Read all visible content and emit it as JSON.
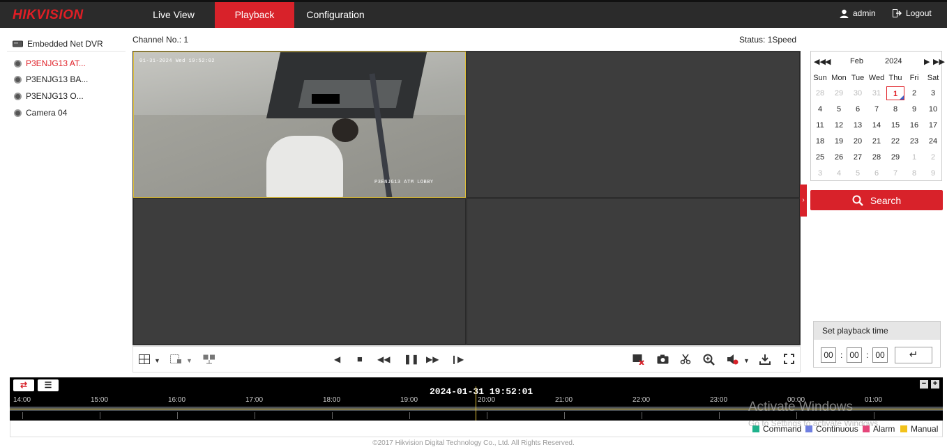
{
  "header": {
    "logo": "HIKVISION",
    "tabs": [
      {
        "label": "Live View"
      },
      {
        "label": "Playback"
      },
      {
        "label": "Configuration"
      }
    ],
    "user": "admin",
    "logout": "Logout"
  },
  "sidebar": {
    "device": "Embedded Net DVR",
    "cameras": [
      {
        "label": "P3ENJG13 AT..."
      },
      {
        "label": "P3ENJG13 BA..."
      },
      {
        "label": "P3ENJG13 O..."
      },
      {
        "label": "Camera 04"
      }
    ]
  },
  "channel": "Channel No.: 1",
  "status": "Status: 1Speed",
  "video": {
    "osd_time": "01-31-2024 Wed 19:52:02",
    "osd_name": "P3ENJG13 ATM LOBBY"
  },
  "calendar": {
    "month": "Feb",
    "year": "2024",
    "weekdays": [
      "Sun",
      "Mon",
      "Tue",
      "Wed",
      "Thu",
      "Fri",
      "Sat"
    ],
    "rows": [
      [
        "28",
        "29",
        "30",
        "31",
        "1",
        "2",
        "3"
      ],
      [
        "4",
        "5",
        "6",
        "7",
        "8",
        "9",
        "10"
      ],
      [
        "11",
        "12",
        "13",
        "14",
        "15",
        "16",
        "17"
      ],
      [
        "18",
        "19",
        "20",
        "21",
        "22",
        "23",
        "24"
      ],
      [
        "25",
        "26",
        "27",
        "28",
        "29",
        "1",
        "2"
      ],
      [
        "3",
        "4",
        "5",
        "6",
        "7",
        "8",
        "9"
      ]
    ]
  },
  "search": {
    "label": "Search"
  },
  "playback_time": {
    "title": "Set playback time",
    "hh": "00",
    "mm": "00",
    "ss": "00"
  },
  "timeline": {
    "current": "2024-01-31 19:52:01",
    "ticks": [
      "14:00",
      "15:00",
      "16:00",
      "17:00",
      "18:00",
      "19:00",
      "20:00",
      "21:00",
      "22:00",
      "23:00",
      "00:00",
      "01:00"
    ]
  },
  "legend": [
    {
      "label": "Command",
      "color": "#1fb28c"
    },
    {
      "label": "Continuous",
      "color": "#6f7fe0"
    },
    {
      "label": "Alarm",
      "color": "#e5467a"
    },
    {
      "label": "Manual",
      "color": "#f2c21b"
    }
  ],
  "footer": "©2017 Hikvision Digital Technology Co., Ltd. All Rights Reserved.",
  "watermark": {
    "line1": "Activate Windows",
    "line2": "Go to Settings to activate Windows."
  }
}
